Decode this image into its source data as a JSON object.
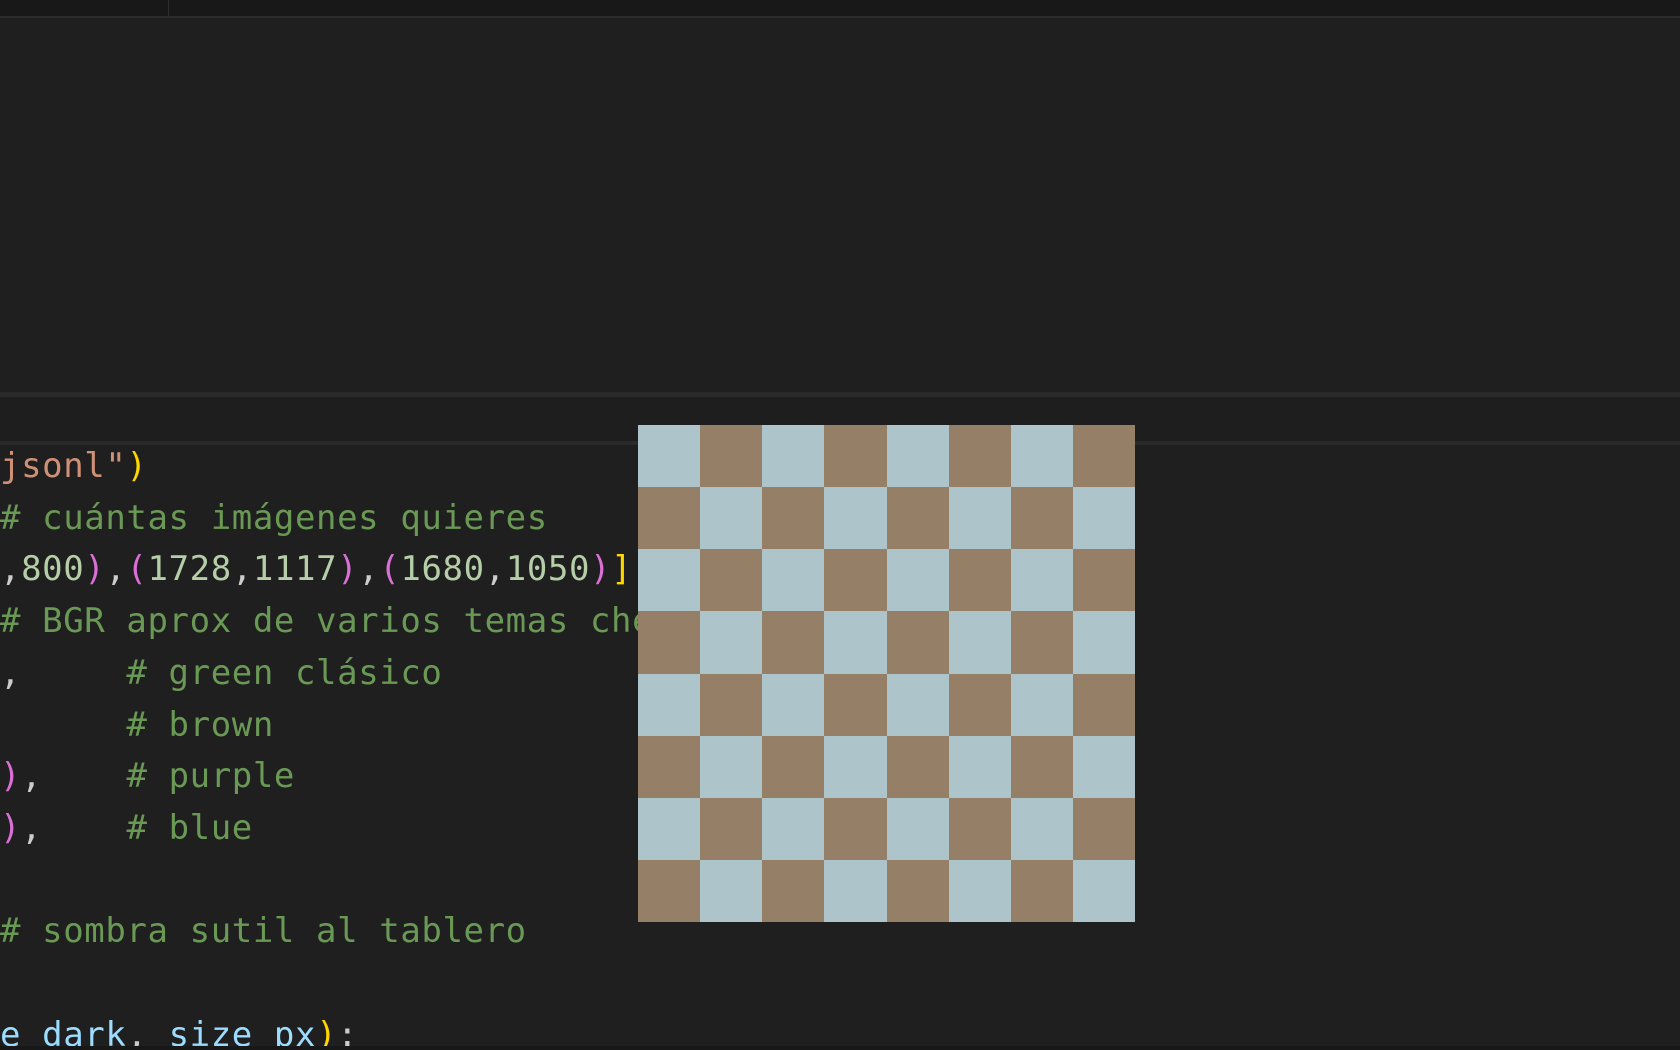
{
  "editor": {
    "lines": [
      {
        "tokens": [
          {
            "t": "jsonl\"",
            "c": "str"
          },
          {
            "t": ")",
            "c": "br1"
          }
        ]
      },
      {
        "tokens": [
          {
            "t": "# cuántas imágenes quieres",
            "c": "com"
          }
        ]
      },
      {
        "tokens": [
          {
            "t": ",",
            "c": "pun"
          },
          {
            "t": "800",
            "c": "num"
          },
          {
            "t": ")",
            "c": "br2"
          },
          {
            "t": ",",
            "c": "pun"
          },
          {
            "t": "(",
            "c": "br2"
          },
          {
            "t": "1728",
            "c": "num"
          },
          {
            "t": ",",
            "c": "pun"
          },
          {
            "t": "1117",
            "c": "num"
          },
          {
            "t": ")",
            "c": "br2"
          },
          {
            "t": ",",
            "c": "pun"
          },
          {
            "t": "(",
            "c": "br2"
          },
          {
            "t": "1680",
            "c": "num"
          },
          {
            "t": ",",
            "c": "pun"
          },
          {
            "t": "1050",
            "c": "num"
          },
          {
            "t": ")",
            "c": "br2"
          },
          {
            "t": "]",
            "c": "br1"
          }
        ]
      },
      {
        "tokens": [
          {
            "t": "# BGR aprox de varios temas che",
            "c": "com"
          }
        ]
      },
      {
        "tokens": [
          {
            "t": ",     ",
            "c": "pun"
          },
          {
            "t": "# green clásico",
            "c": "com"
          }
        ]
      },
      {
        "tokens": [
          {
            "t": "      ",
            "c": "pun"
          },
          {
            "t": "# brown",
            "c": "com"
          }
        ]
      },
      {
        "tokens": [
          {
            "t": ")",
            "c": "br2"
          },
          {
            "t": ",    ",
            "c": "pun"
          },
          {
            "t": "# purple",
            "c": "com"
          }
        ]
      },
      {
        "tokens": [
          {
            "t": ")",
            "c": "br2"
          },
          {
            "t": ",    ",
            "c": "pun"
          },
          {
            "t": "# blue",
            "c": "com"
          }
        ]
      },
      {
        "tokens": []
      },
      {
        "tokens": [
          {
            "t": "# sombra sutil al tablero",
            "c": "com"
          }
        ]
      },
      {
        "tokens": []
      },
      {
        "tokens": [
          {
            "t": "e",
            "c": "var"
          },
          {
            "t": " ",
            "c": "pun"
          },
          {
            "t": "dark",
            "c": "var"
          },
          {
            "t": ", ",
            "c": "pun"
          },
          {
            "t": "size_px",
            "c": "var"
          },
          {
            "t": ")",
            "c": "br1"
          },
          {
            "t": ":",
            "c": "pun"
          }
        ]
      }
    ]
  },
  "board": {
    "rows": 8,
    "cols": 8,
    "light_color": "#adc4cb",
    "dark_color": "#957f66"
  }
}
